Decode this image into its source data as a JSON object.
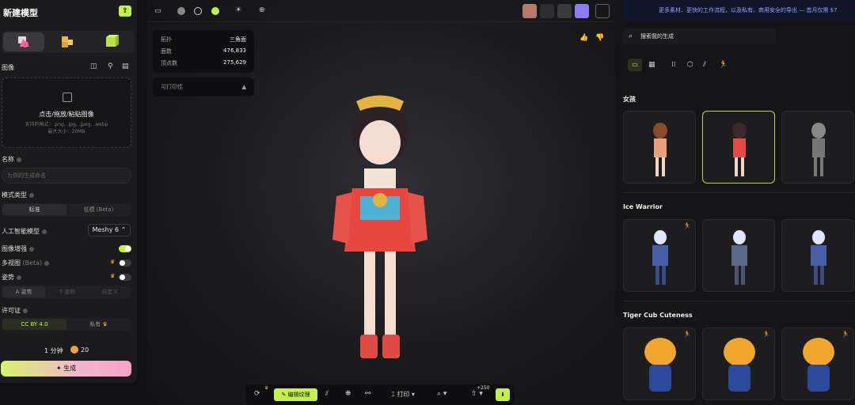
{
  "left": {
    "title": "新建模型",
    "image_label": "图像",
    "dropzone": {
      "main": "点击/拖放/粘贴图像",
      "formats": "支持的格式：.png, .jpg, .jpeg, .webp",
      "maxsize": "最大大小：20MB"
    },
    "name_label": "名称",
    "name_placeholder": "为你的生成命名",
    "model_type_label": "模式类型",
    "model_type_options": [
      "标准",
      "低模 (Beta)"
    ],
    "ai_model_label": "人工智能模型",
    "ai_model_value": "Meshy 6",
    "enhance_label": "图像增强",
    "multiview_label": "多视图",
    "multiview_beta": "(Beta)",
    "pose_label": "姿势",
    "pose_options": [
      "A 姿势",
      "T 姿势",
      "自定义"
    ],
    "license_label": "许可证",
    "license_options": [
      "CC BY 4.0",
      "私有"
    ],
    "time": "1 分钟",
    "credits": "20",
    "generate": "生成"
  },
  "stats": {
    "topology_label": "拓扑",
    "topology_value": "三角面",
    "faces_label": "面数",
    "faces_value": "476,833",
    "verts_label": "顶点数",
    "verts_value": "275,629",
    "printability": "可打印性"
  },
  "toolbar": {
    "edit_texture": "编辑纹理",
    "print": "打印",
    "badge": "+250"
  },
  "right": {
    "banner": "更多素材、更快的工作流程，以及私有、商用安全的导出 — 首月仅需 $7",
    "search_placeholder": "搜索我的生成",
    "groups": [
      "女孩",
      "Ice Warrior",
      "Tiger Cub Cuteness"
    ]
  },
  "colors": {
    "accent": "#c5f04b",
    "selected_border": "#bcd24f"
  }
}
